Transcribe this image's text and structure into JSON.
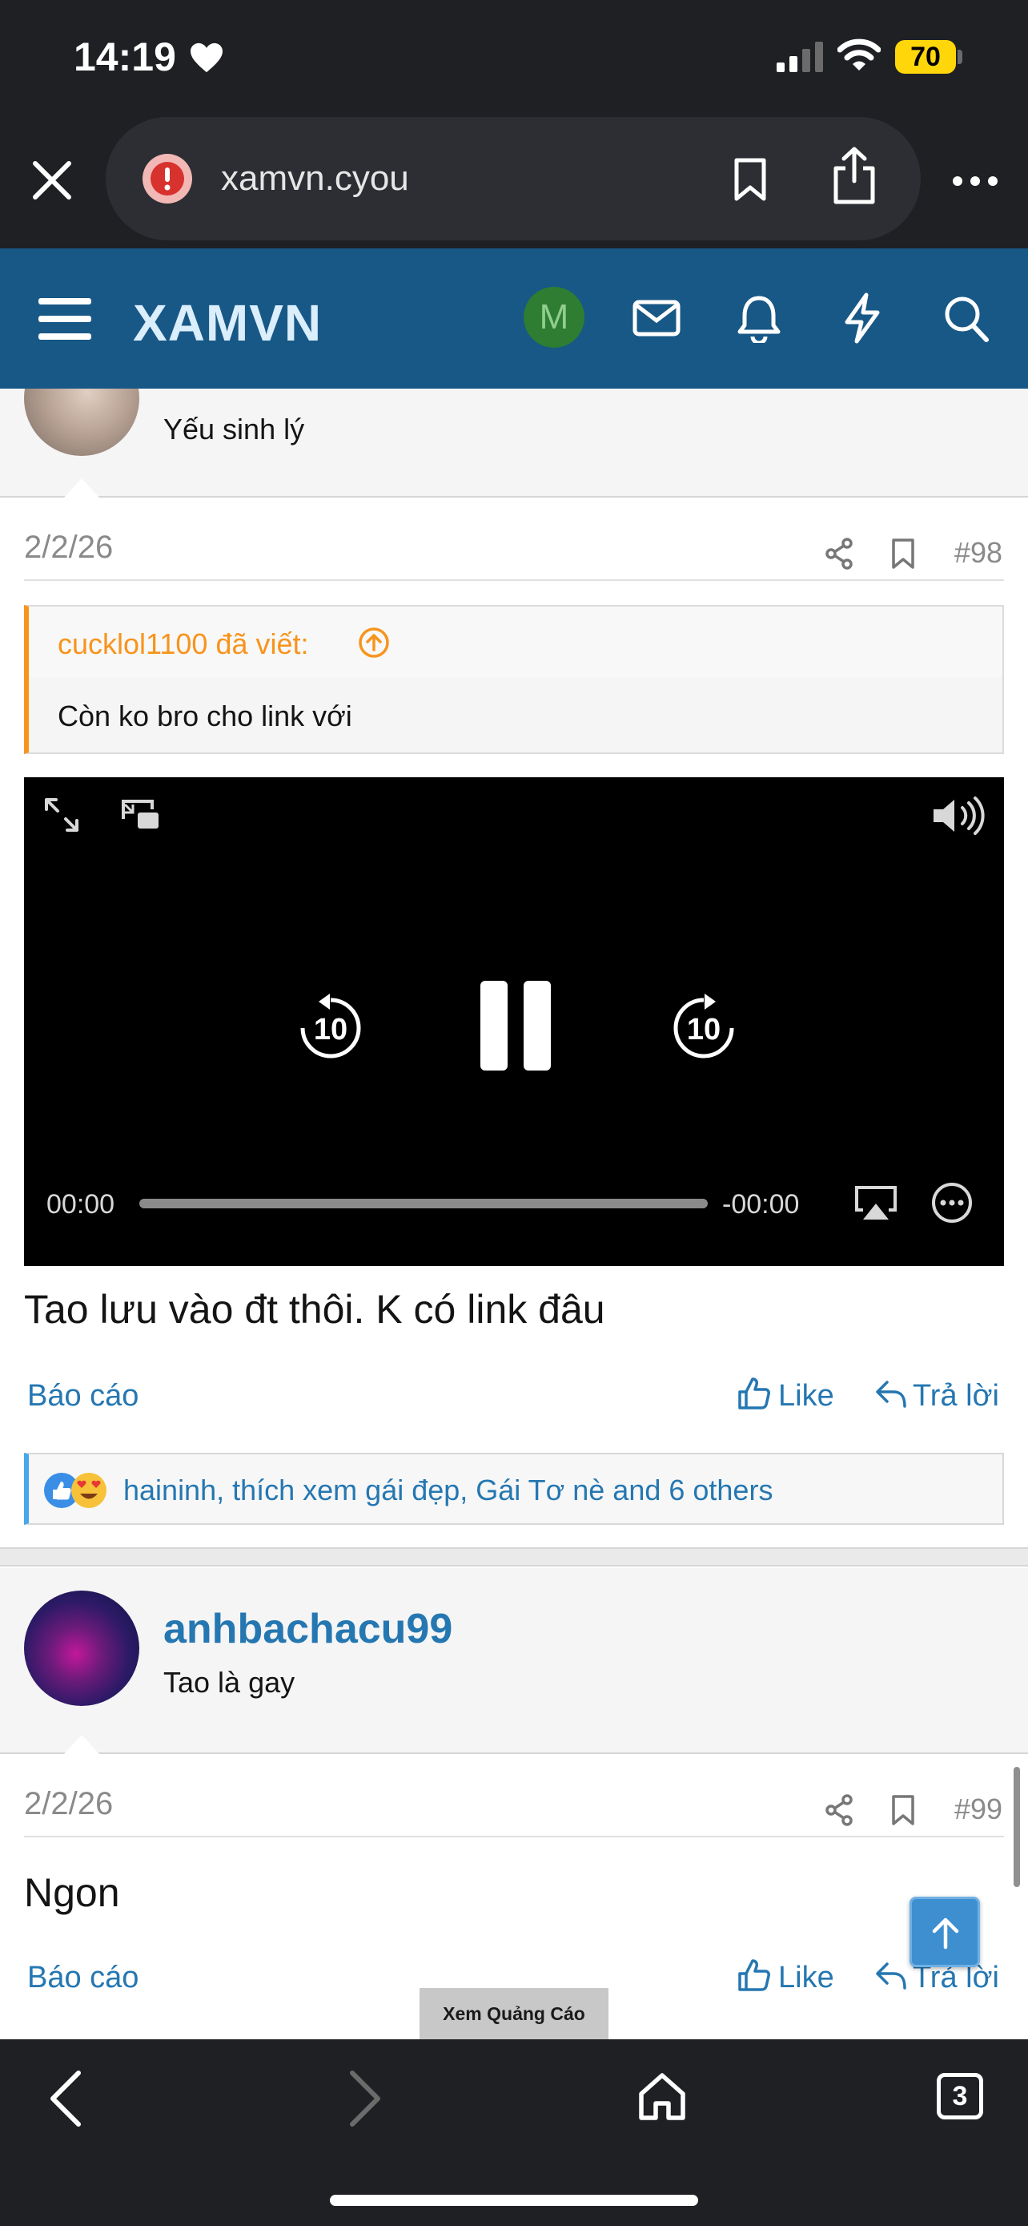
{
  "status_bar": {
    "time": "14:19",
    "battery": "70"
  },
  "browser": {
    "url": "xamvn.cyou"
  },
  "site": {
    "logo": "XAMVN",
    "avatar_letter": "M",
    "colors": {
      "header": "#185886",
      "link": "#2577b1",
      "quote_border": "#f7941d",
      "avatar_bg": "#2e7d32"
    }
  },
  "posts": [
    {
      "user_title": "Yếu sinh lý",
      "date": "2/2/26",
      "number": "#98",
      "quote_author": "cucklol1100 đã viết:",
      "quote_text": "Còn ko bro cho link với",
      "video": {
        "current_time": "00:00",
        "remaining_time": "-00:00",
        "skip_back": "10",
        "skip_forward": "10"
      },
      "body": "Tao lưu vào đt thôi. K có link đâu",
      "report_label": "Báo cáo",
      "like_label": "Like",
      "reply_label": "Trả lời",
      "reactions_text": "haininh, thích xem gái đẹp, Gái Tơ nè and 6 others"
    },
    {
      "username": "anhbachacu99",
      "user_title": "Tao là gay",
      "date": "2/2/26",
      "number": "#99",
      "body": "Ngon",
      "report_label": "Báo cáo",
      "like_label": "Like",
      "reply_label": "Trả lời"
    }
  ],
  "ad_label": "Xem Quảng Cáo",
  "tabs_count": "3"
}
